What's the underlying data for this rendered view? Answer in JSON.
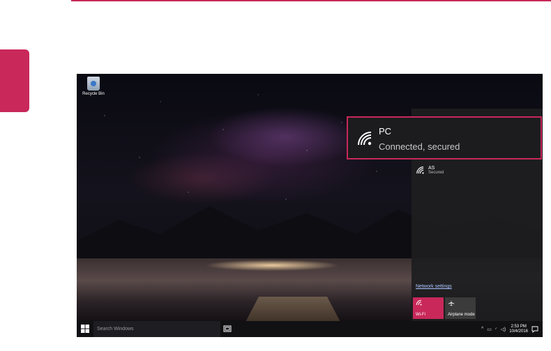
{
  "accent_color": "#c8285a",
  "desktop": {
    "recycle_bin_label": "Recycle Bin"
  },
  "network_flyout": {
    "networks": [
      {
        "name": "PC",
        "status": "Connected, secured",
        "icon": "wifi-icon"
      },
      {
        "name": "AS",
        "status": "Secured",
        "icon": "wifi-icon"
      }
    ],
    "settings_link": "Network settings",
    "tiles": [
      {
        "label": "Wi-Fi",
        "icon": "wifi-icon",
        "active": true
      },
      {
        "label": "Airplane mode",
        "icon": "airplane-icon",
        "active": false
      }
    ]
  },
  "taskbar": {
    "search_placeholder": "Search Windows",
    "time": "2:53 PM",
    "date": "10/4/2016"
  }
}
